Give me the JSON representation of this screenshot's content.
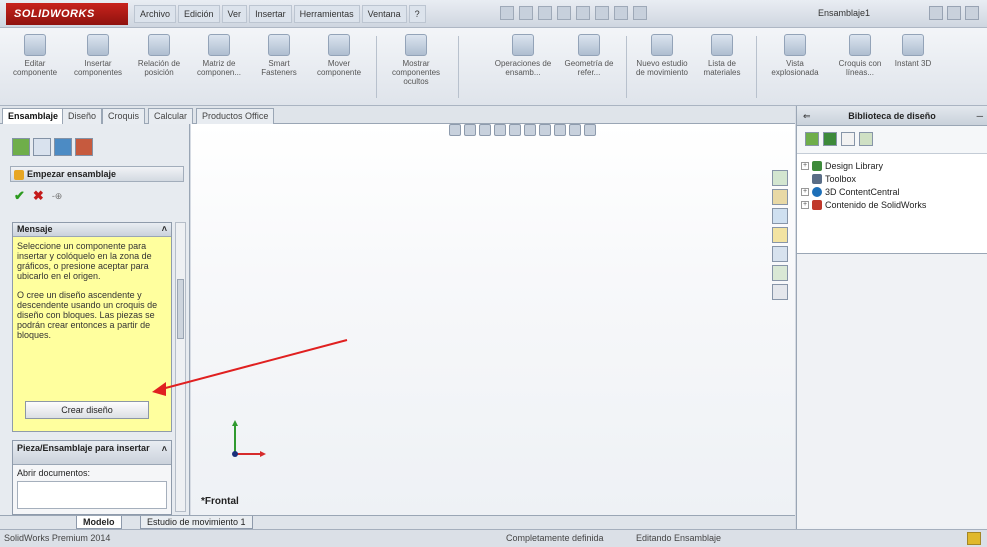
{
  "app": {
    "brand": "SOLIDWORKS",
    "document_title": "Ensamblaje1"
  },
  "menu": [
    "Archivo",
    "Edición",
    "Ver",
    "Insertar",
    "Herramientas",
    "Ventana",
    "?"
  ],
  "commands": [
    "Editar componente",
    "Insertar componentes",
    "Relación de posición",
    "Matriz de componen...",
    "Smart Fasteners",
    "Mover componente",
    "Mostrar componentes ocultos",
    "Operaciones de ensamb...",
    "Geometría de refer...",
    "Nuevo estudio de movimiento",
    "Lista de materiales",
    "Vista explosionada",
    "Croquis con líneas...",
    "Instant 3D"
  ],
  "tabs": [
    "Ensamblaje",
    "Diseño",
    "Croquis",
    "Calcular",
    "Productos Office"
  ],
  "property_manager": {
    "title": "Empezar ensamblaje",
    "message_header": "Mensaje",
    "message_p1": "Seleccione un componente para insertar y colóquelo en la zona de gráficos, o presione aceptar para ubicarlo en el origen.",
    "message_p2": "O cree un diseño ascendente y descendente usando un croquis de diseño con bloques. Las piezas se podrán crear entonces a partir de bloques.",
    "create_layout_button": "Crear diseño",
    "part_section_header": "Pieza/Ensamblaje para insertar",
    "open_docs_label": "Abrir documentos:"
  },
  "viewport": {
    "view_name": "*Frontal"
  },
  "bottom_tabs": [
    "Modelo",
    "Estudio de movimiento 1"
  ],
  "design_library": {
    "title": "Biblioteca de diseño",
    "items": [
      {
        "label": "Design Library",
        "icon": "library-icon",
        "color": "#3d8a3a"
      },
      {
        "label": "Toolbox",
        "icon": "toolbox-icon",
        "color": "#5a6d86"
      },
      {
        "label": "3D ContentCentral",
        "icon": "globe-icon",
        "color": "#1d6fb8"
      },
      {
        "label": "Contenido de SolidWorks",
        "icon": "content-icon",
        "color": "#c0392b"
      }
    ]
  },
  "status": {
    "product": "SolidWorks Premium 2014",
    "defined": "Completamente definida",
    "mode": "Editando Ensamblaje"
  }
}
